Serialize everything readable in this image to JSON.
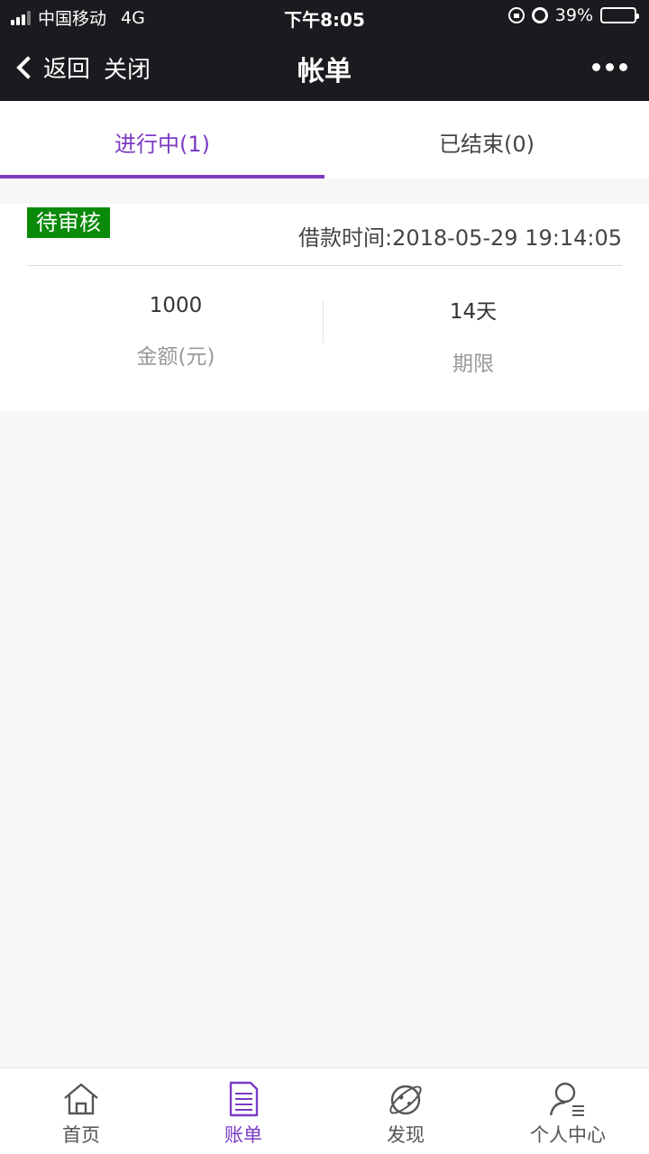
{
  "status_bar": {
    "carrier": "中国移动",
    "network": "4G",
    "time": "下午8:05",
    "battery": "39%",
    "battery_level": 0.39
  },
  "nav": {
    "back_label": "返回",
    "close_label": "关闭",
    "title": "帐单"
  },
  "tabs": [
    {
      "label": "进行中(1)",
      "active": true
    },
    {
      "label": "已结束(0)",
      "active": false
    }
  ],
  "loan_card": {
    "status": "待审核",
    "loan_time": "借款时间:2018-05-29 19:14:05",
    "amount_value": "1000",
    "amount_label": "金额(元)",
    "term_value": "14天",
    "term_label": "期限"
  },
  "bottom_nav": [
    {
      "label": "首页",
      "icon": "home-icon",
      "active": false
    },
    {
      "label": "账单",
      "icon": "bill-icon",
      "active": true
    },
    {
      "label": "发现",
      "icon": "planet-icon",
      "active": false
    },
    {
      "label": "个人中心",
      "icon": "user-icon",
      "active": false
    }
  ],
  "colors": {
    "accent": "#7b3bc4",
    "status_badge": "#0a8a0a",
    "header_bg": "#1b1b1f"
  }
}
